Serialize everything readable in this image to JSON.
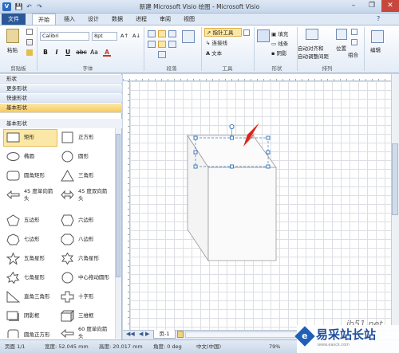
{
  "titlebar": {
    "app_icon": "V",
    "title": "新建 Microsoft Visio 绘图 - Microsoft Visio",
    "qa_save": "💾",
    "qa_undo": "↶",
    "qa_redo": "↷",
    "minimize": "–",
    "maximize": "❐",
    "close": "✕"
  },
  "tabs": [
    "文件",
    "开始",
    "插入",
    "设计",
    "数据",
    "进程",
    "审阅",
    "视图"
  ],
  "ribbon": {
    "clipboard": {
      "paste": "粘贴",
      "label": "剪贴板"
    },
    "font": {
      "name": "Calibri",
      "size": "8pt",
      "label": "字体",
      "bold": "B",
      "italic": "I",
      "underline": "U",
      "strike": "abc",
      "grow": "A↑",
      "shrink": "A↓",
      "color": "A"
    },
    "paragraph": {
      "label": "段落"
    },
    "tools": {
      "pointer": "指针工具",
      "connector": "连接线",
      "text": "文本",
      "label": "工具"
    },
    "shape": {
      "fill": "填充",
      "line": "线条",
      "shadow": "阴影",
      "label": "形状"
    },
    "arrange": {
      "auto_align": "自动对齐和",
      "auto_space": "自动调整间距",
      "position": "位置",
      "group": "组合",
      "label": "排列"
    },
    "editing": {
      "edit": "编辑"
    }
  },
  "sidebar": {
    "title": "形状",
    "rows": [
      "更多形状",
      "快速形状",
      "基本形状"
    ],
    "header": "基本形状",
    "shapes": [
      {
        "left": "矩形",
        "right": "正方形"
      },
      {
        "left": "椭圆",
        "right": "圆形"
      },
      {
        "left": "圆角矩形",
        "right": "三角形"
      },
      {
        "left": "45 度单向箭头",
        "right": "45 度双向箭头"
      },
      {
        "left": "五边形",
        "right": "六边形"
      },
      {
        "left": "七边形",
        "right": "八边形"
      },
      {
        "left": "五角星形",
        "right": "六角星形"
      },
      {
        "left": "七角星形",
        "right": "中心拖动圆形"
      },
      {
        "left": "直角三角形",
        "right": "十字形"
      },
      {
        "left": "阴影框",
        "right": "三维框"
      },
      {
        "left": "圆角正方形",
        "right": "60 度单向箭头"
      }
    ]
  },
  "page": {
    "tab": "页-1"
  },
  "status": {
    "page": "页面 1/1",
    "width": "宽度: 52.045 mm",
    "height": "高度: 20.017 mm",
    "angle": "角度: 0 deg",
    "lang": "中文(中国)",
    "zoom": "79%"
  },
  "watermark": {
    "url": "jb51.net",
    "brand": "易采站长站",
    "sub": "www.easck.com"
  }
}
